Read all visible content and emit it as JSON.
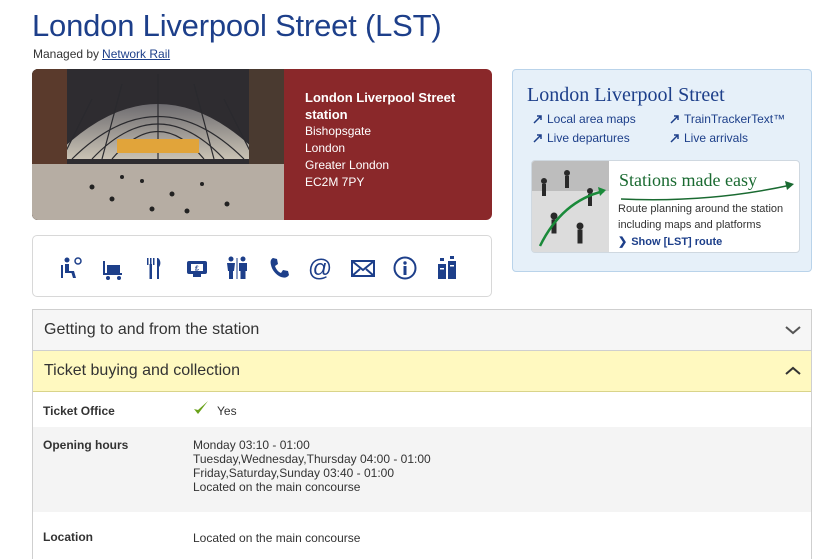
{
  "page": {
    "title": "London Liverpool Street (LST)",
    "managed_by_prefix": "Managed by",
    "managed_by_link": "Network Rail"
  },
  "station": {
    "name": "London Liverpool Street station",
    "address_lines": [
      "Bishopsgate",
      "London",
      "Greater London",
      "EC2M 7PY"
    ]
  },
  "facilities": {
    "icons": [
      "waiting-room-icon",
      "trolley-icon",
      "food-icon",
      "ticket-machine-icon",
      "toilets-icon",
      "phone-icon",
      "at-icon",
      "mail-icon",
      "info-icon",
      "lockers-icon"
    ]
  },
  "info_box": {
    "title": "London Liverpool Street",
    "links": [
      "Local area maps",
      "TrainTrackerText™",
      "Live departures",
      "Live arrivals"
    ],
    "promo_title": "Stations made easy",
    "promo_text": "Route planning around the station including maps and platforms",
    "promo_link": "Show [LST] route"
  },
  "accordion": {
    "section1": "Getting to and from the station",
    "section2": "Ticket buying and collection",
    "rows": {
      "ticket_office_label": "Ticket Office",
      "ticket_office_value": "Yes",
      "opening_hours_label": "Opening hours",
      "opening_hours_lines": [
        "Monday 03:10 - 01:00",
        "Tuesday,Wednesday,Thursday 04:00 - 01:00",
        "Friday,Saturday,Sunday 03:40 - 01:00",
        "Located on the main concourse"
      ],
      "location_label": "Location",
      "location_value": "Located on the main concourse"
    }
  },
  "colors": {
    "brand_blue": "#1d3f8a",
    "address_panel": "#8a282a",
    "open_section": "#fff9c0",
    "tick_green": "#6aa21b"
  }
}
